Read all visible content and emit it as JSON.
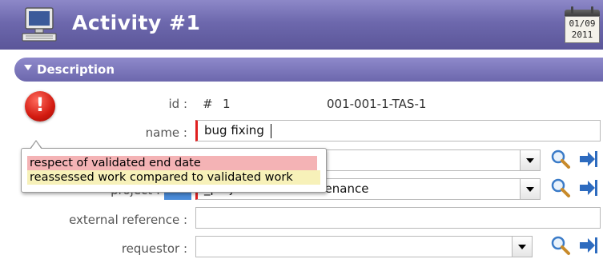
{
  "header": {
    "title": "Activity  #1",
    "calendar": {
      "date": "01/09",
      "year": "2011"
    }
  },
  "section": {
    "label": "Description"
  },
  "form": {
    "id": {
      "label": "id :",
      "hash": "#",
      "number": "1",
      "reference": "001-001-1-TAS-1"
    },
    "name": {
      "label": "name :",
      "value": "bug fixing"
    },
    "project": {
      "label": "project :",
      "value": "_project one - maintenance"
    },
    "external_reference": {
      "label": "external reference :",
      "value": ""
    },
    "requestor": {
      "label": "requestor :",
      "value": ""
    }
  },
  "tooltip": {
    "line1": "respect of validated end date",
    "line2": "reassessed work compared to validated work"
  },
  "colors": {
    "header": "#6d68ad",
    "required": "#e02020",
    "alert": "#d21a10",
    "tooltip_red": "#f4b3b5",
    "tooltip_yellow": "#f7f1b9"
  },
  "icons": [
    "computer-icon",
    "calendar-icon",
    "alert-icon",
    "search-icon",
    "goto-icon"
  ]
}
